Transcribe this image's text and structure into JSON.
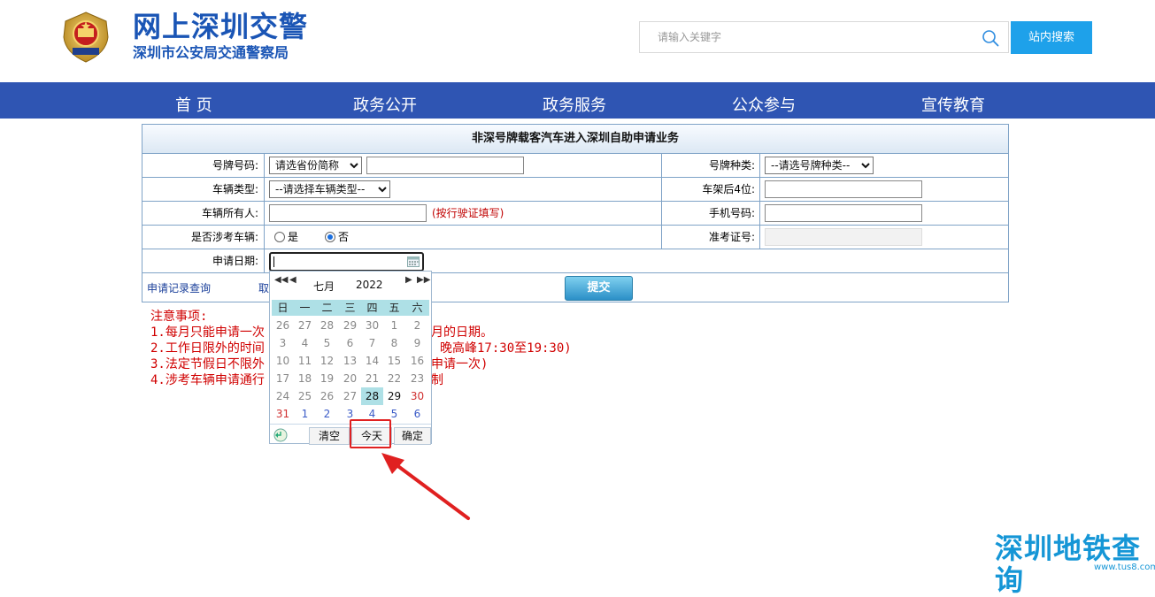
{
  "header": {
    "title": "网上深圳交警",
    "subtitle": "深圳市公安局交通警察局",
    "emblem_icon": "police-emblem-icon"
  },
  "search": {
    "placeholder": "请输入关键字",
    "button_label": "站内搜索"
  },
  "nav": {
    "items": [
      "首 页",
      "政务公开",
      "政务服务",
      "公众参与",
      "宣传教育"
    ]
  },
  "form": {
    "title": "非深号牌载客汽车进入深圳自助申请业务",
    "plate_number_label": "号牌号码:",
    "province_select": "请选省份简称",
    "plate_type_label": "号牌种类:",
    "plate_type_select": "--请选号牌种类--",
    "vehicle_type_label": "车辆类型:",
    "vehicle_type_select": "--请选择车辆类型--",
    "vin_label": "车架后4位:",
    "owner_label": "车辆所有人:",
    "owner_hint": "(按行驶证填写)",
    "phone_label": "手机号码:",
    "exam_label": "是否涉考车辆:",
    "exam_yes": "是",
    "exam_no": "否",
    "exam_selected": "否",
    "exam_id_label": "准考证号:",
    "date_label": "申请日期:",
    "record_link": "申请记录查询",
    "cancel_link": "取",
    "submit_label": "提交"
  },
  "notes": {
    "heading": "注意事项:",
    "lines": [
      "1.每月只能申请一次",
      "2.工作日限外的时间",
      "3.法定节假日不限外",
      "4.涉考车辆申请通行"
    ],
    "tails": [
      "月的日期。",
      "晚高峰17:30至19:30)",
      "申请一次)",
      "制"
    ]
  },
  "calendar": {
    "prev_year": "◀◀",
    "prev_month": "◀",
    "month": "七月",
    "year": "2022",
    "next_month": "▶",
    "next_year": "▶▶",
    "weekdays": [
      "日",
      "一",
      "二",
      "三",
      "四",
      "五",
      "六"
    ],
    "weeks": [
      [
        "26",
        "27",
        "28",
        "29",
        "30",
        "1",
        "2"
      ],
      [
        "3",
        "4",
        "5",
        "6",
        "7",
        "8",
        "9"
      ],
      [
        "10",
        "11",
        "12",
        "13",
        "14",
        "15",
        "16"
      ],
      [
        "17",
        "18",
        "19",
        "20",
        "21",
        "22",
        "23"
      ],
      [
        "24",
        "25",
        "26",
        "27",
        "28",
        "29",
        "30"
      ],
      [
        "31",
        "1",
        "2",
        "3",
        "4",
        "5",
        "6"
      ]
    ],
    "selected_day": "28",
    "clear_label": "清空",
    "today_label": "今天",
    "ok_label": "确定",
    "time_icon": "clock-icon"
  },
  "watermark": {
    "text": "深圳地铁查询",
    "url": "www.tus8.com"
  },
  "colors": {
    "brand_blue": "#1a55b5",
    "nav_bg": "#2f55b3",
    "search_btn": "#1ea1ea",
    "hint_red": "#c00000",
    "highlight_red": "#e02020",
    "calendar_accent": "#aee0e6"
  }
}
